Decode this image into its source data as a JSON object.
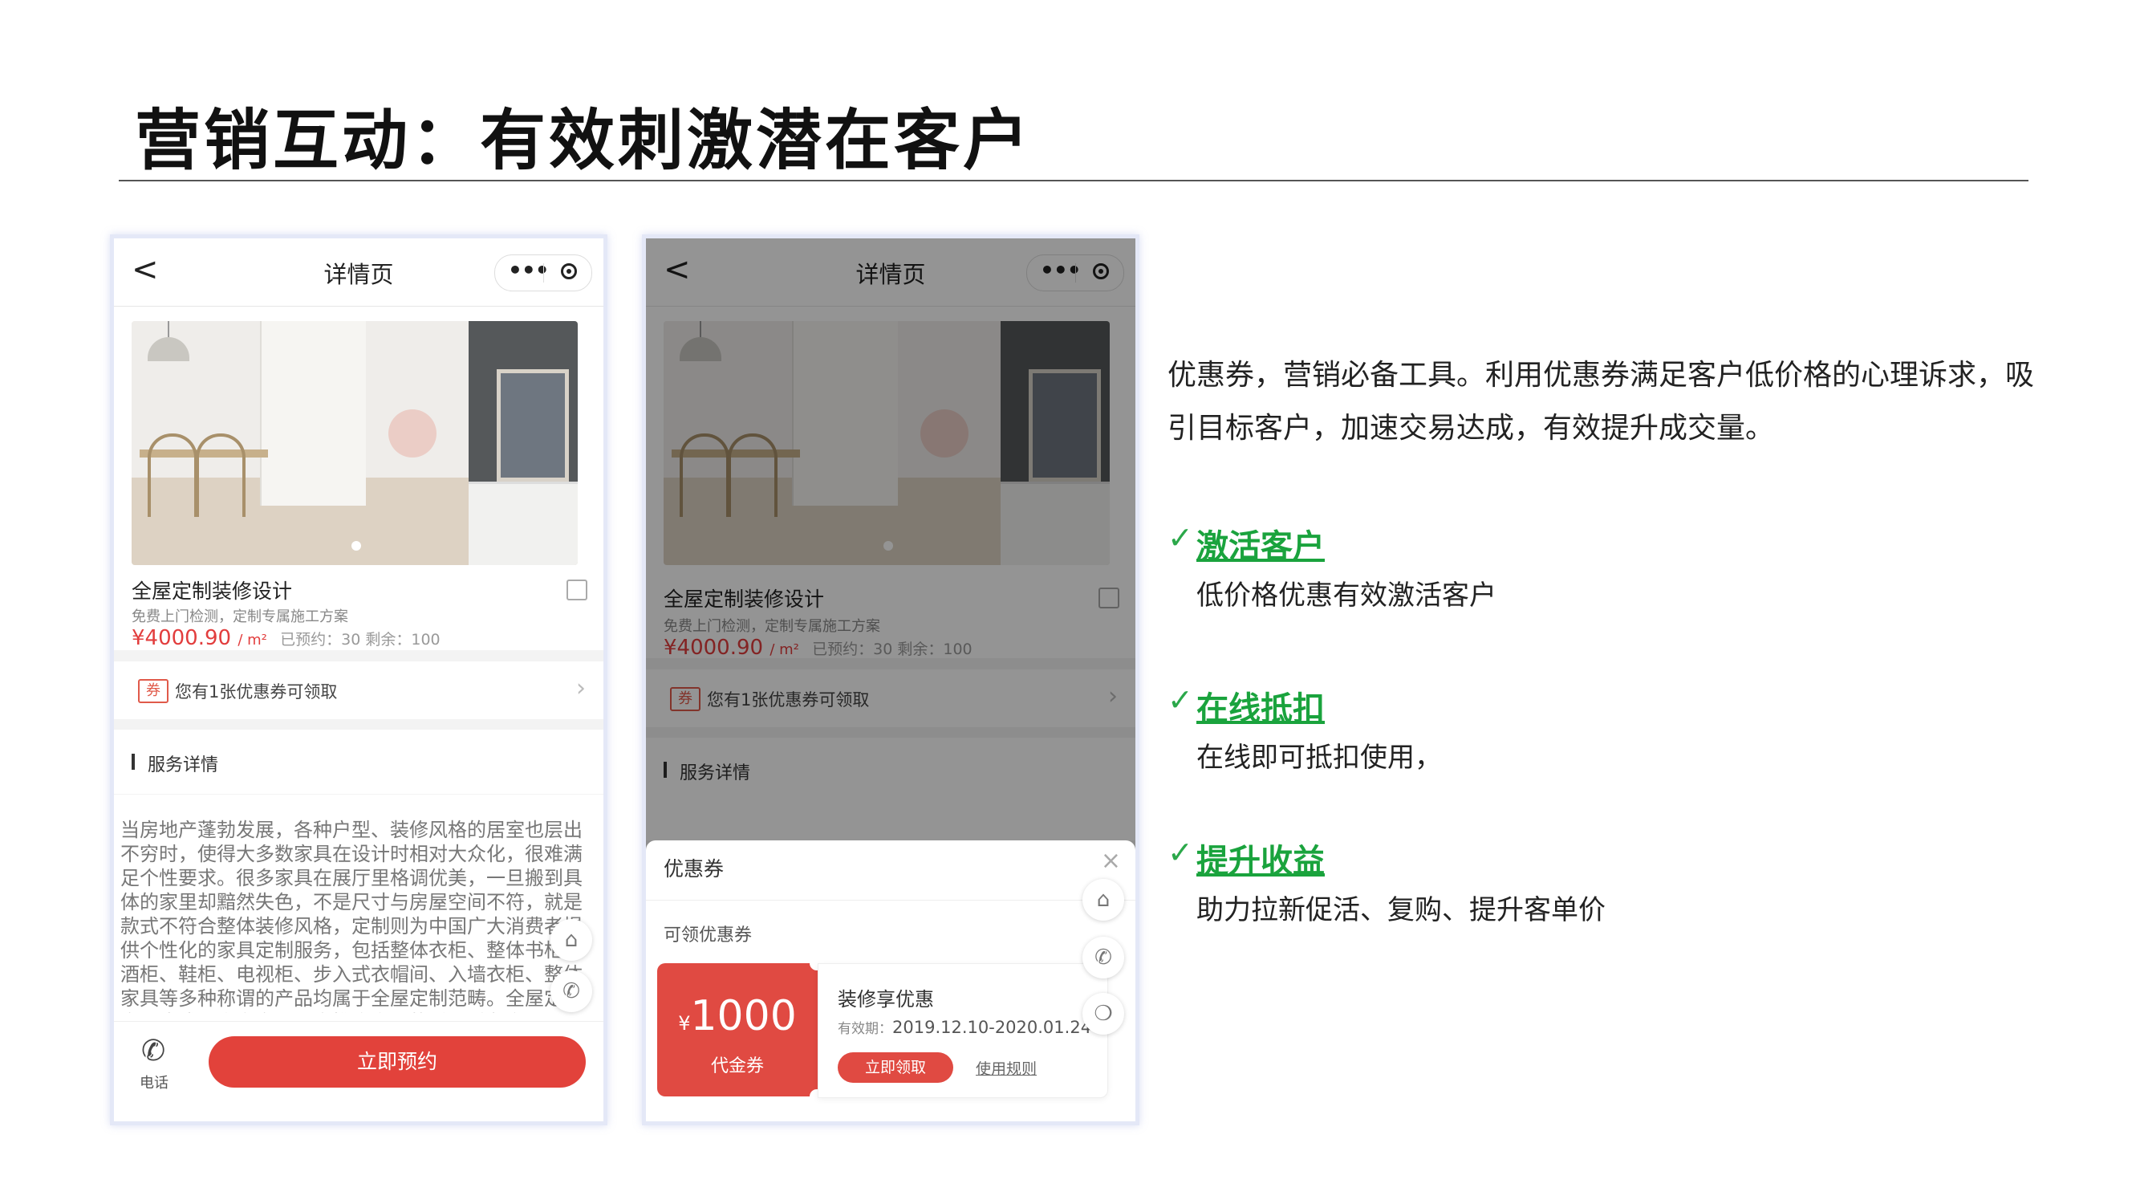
{
  "slide": {
    "title": "营销互动：有效刺激潜在客户"
  },
  "phone1": {
    "nav_back": "<",
    "nav_title": "详情页",
    "capsule_more": "•••",
    "product": {
      "name": "全屋定制装修设计",
      "subtitle": "免费上门检测，定制专属施工方案",
      "price": "¥4000.90",
      "price_unit": "/ m²",
      "stock_meta": "已预约：30  剩余：100"
    },
    "coupon_row": {
      "tag": "券",
      "text": "您有1张优惠券可领取",
      "arrow": "›"
    },
    "service": {
      "label": "服务详情",
      "body": "当房地产蓬勃发展，各种户型、装修风格的居室也层出不穷时，使得大多数家具在设计时相对大众化，很难满足个性要求。很多家具在展厅里格调优美，一旦搬到具体的家里却黯然失色，不是尺寸与房屋空间不符，就是款式不符合整体装修风格，定制则为中国广大消费者提供个性化的家具定制服务，包括整体衣柜、整体书柜、酒柜、鞋柜、电视柜、步入式衣帽间、入墙衣柜、整体家具等多种称谓的产品均属于全屋定制范畴。全屋定制家具也成了众多家具厂商推广产品的重要手段之一"
    },
    "bottom": {
      "phone_icon": "✆",
      "phone_label": "电话",
      "book_button": "立即预约"
    },
    "float_icons": {
      "home": "⌂",
      "call": "✆"
    }
  },
  "phone2": {
    "nav_back": "<",
    "nav_title": "详情页",
    "capsule_more": "•••",
    "product": {
      "name": "全屋定制装修设计",
      "subtitle": "免费上门检测，定制专属施工方案",
      "price": "¥4000.90",
      "price_unit": "/ m²",
      "stock_meta": "已预约：30  剩余：100"
    },
    "coupon_row": {
      "tag": "券",
      "text": "您有1张优惠券可领取",
      "arrow": "›"
    },
    "service": {
      "label": "服务详情"
    },
    "sheet": {
      "title": "优惠券",
      "close": "×",
      "section": "可领优惠券",
      "coupon": {
        "currency": "¥",
        "amount": "1000",
        "kind": "代金券",
        "name": "装修享优惠",
        "validity_label": "有效期：",
        "validity_dates": "2019.12.10-2020.01.24",
        "get_button": "立即领取",
        "rules_link": "使用规则"
      }
    },
    "float_icons": {
      "home": "⌂",
      "call": "✆",
      "chat": "❍"
    }
  },
  "right": {
    "intro": "优惠券，营销必备工具。利用优惠券满足客户低价格的心理诉求，吸引目标客户，加速交易达成，有效提升成交量。",
    "check_mark": "✓",
    "features": [
      {
        "heading": "激活客户",
        "desc": "低价格优惠有效激活客户"
      },
      {
        "heading": "在线抵扣",
        "desc": "在线即可抵扣使用，"
      },
      {
        "heading": "提升收益",
        "desc": "助力拉新促活、复购、提升客单价"
      }
    ]
  },
  "colors": {
    "accent_red": "#e2423b",
    "accent_green": "#1aa33d"
  }
}
